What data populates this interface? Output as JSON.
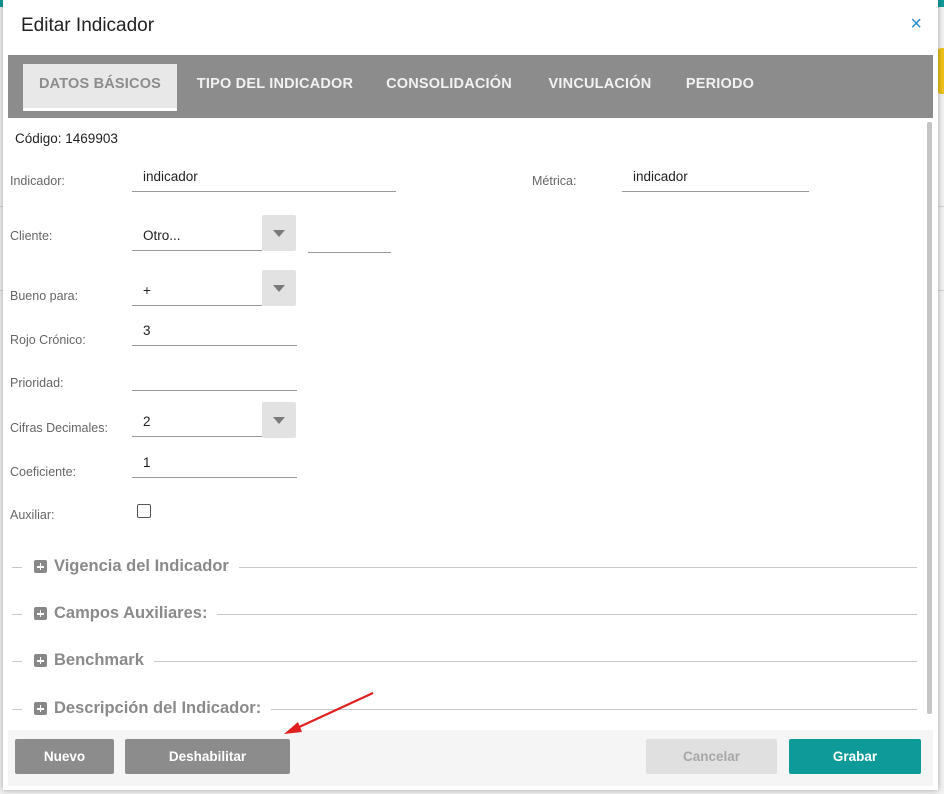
{
  "dialog": {
    "title": "Editar Indicador",
    "close_glyph": "×"
  },
  "tabs": [
    {
      "label": "DATOS BÁSICOS",
      "active": true
    },
    {
      "label": "TIPO DEL INDICADOR",
      "active": false
    },
    {
      "label": "CONSOLIDACIÓN",
      "active": false
    },
    {
      "label": "VINCULACIÓN",
      "active": false
    },
    {
      "label": "PERIODO",
      "active": false
    }
  ],
  "form": {
    "codigo": "Código: 1469903",
    "indicador": {
      "label": "Indicador:",
      "value": "indicador"
    },
    "metrica": {
      "label": "Métrica:",
      "value": "indicador"
    },
    "cliente": {
      "label": "Cliente:",
      "value": "Otro...",
      "extra_value": ""
    },
    "bueno_para": {
      "label": "Bueno para:",
      "value": "+"
    },
    "rojo_cronico": {
      "label": "Rojo Crónico:",
      "value": "3"
    },
    "prioridad": {
      "label": "Prioridad:",
      "value": ""
    },
    "cifras_decimales": {
      "label": "Cifras Decimales:",
      "value": "2"
    },
    "coeficiente": {
      "label": "Coeficiente:",
      "value": "1"
    },
    "auxiliar": {
      "label": "Auxiliar:",
      "checked": false
    }
  },
  "sections": [
    {
      "title": "Vigencia del Indicador"
    },
    {
      "title": "Campos Auxiliares:"
    },
    {
      "title": "Benchmark"
    },
    {
      "title": "Descripción del Indicador:"
    }
  ],
  "footer": {
    "nuevo": "Nuevo",
    "deshabilitar": "Deshabilitar",
    "cancelar": "Cancelar",
    "grabar": "Grabar"
  },
  "colors": {
    "accent": "#0f9a9a",
    "tabbar": "#8c8c8c",
    "annotation_arrow": "#e02020"
  },
  "icons": {
    "close": "close-icon",
    "dropdown": "chevron-down-icon",
    "expand": "plus-square-icon",
    "annotation": "red-arrow-annotation"
  }
}
